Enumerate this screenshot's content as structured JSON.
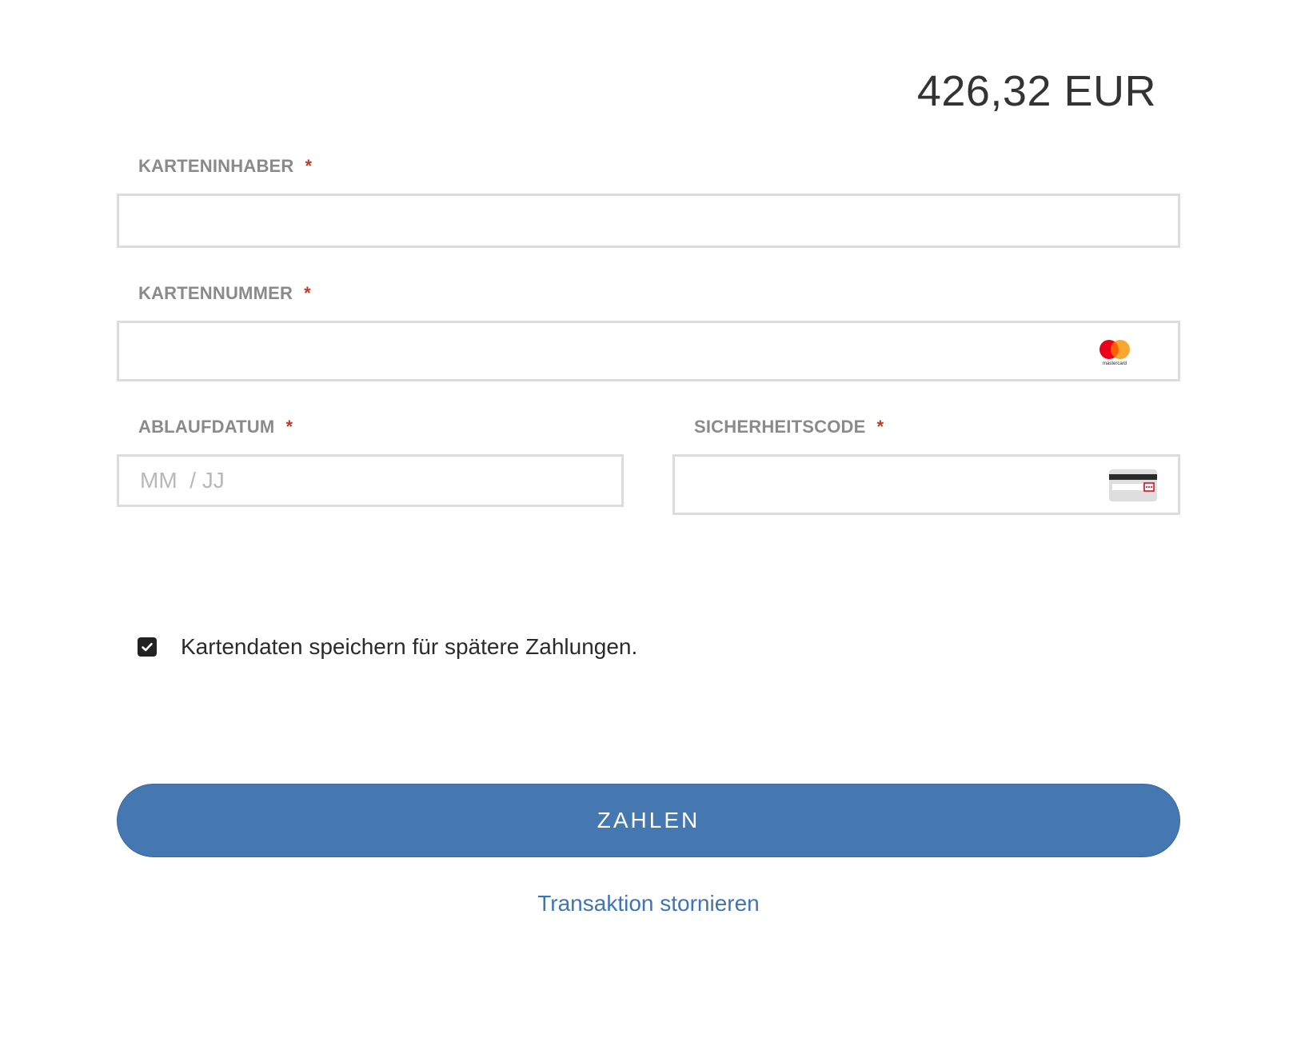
{
  "payment": {
    "amount": "426,32 EUR"
  },
  "fields": {
    "cardholder": {
      "label": "KARTENINHABER",
      "required_mark": "*",
      "value": "",
      "placeholder": ""
    },
    "card_number": {
      "label": "KARTENNUMMER",
      "required_mark": "*",
      "value": "",
      "placeholder": "",
      "brand_icon": "mastercard-logo-icon",
      "brand_text": "mastercard"
    },
    "expiry": {
      "label": "ABLAUFDATUM",
      "required_mark": "*",
      "value": "",
      "placeholder": "MM  / JJ"
    },
    "security_code": {
      "label": "SICHERHEITSCODE",
      "required_mark": "*",
      "value": "",
      "placeholder": "",
      "icon": "card-back-cvc-icon"
    }
  },
  "save_card": {
    "checked": true,
    "label": "Kartendaten speichern für spätere Zahlungen."
  },
  "actions": {
    "pay_label": "ZAHLEN",
    "cancel_label": "Transaktion stornieren"
  },
  "colors": {
    "primary": "#4577b1",
    "link": "#3f74b5",
    "required": "#c0392b",
    "label": "#8a8a8a",
    "border": "#dcdcdc",
    "mastercard_red": "#eb001b",
    "mastercard_orange": "#f79e1b"
  }
}
